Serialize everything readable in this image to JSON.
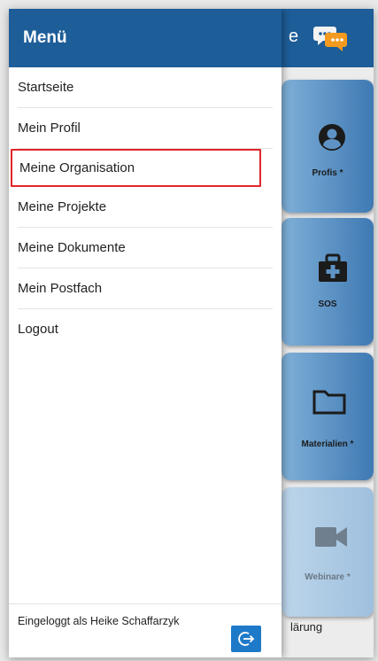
{
  "drawer": {
    "title": "Menü",
    "items": [
      {
        "label": "Startseite"
      },
      {
        "label": "Mein Profil"
      },
      {
        "label": "Meine Organisation"
      },
      {
        "label": "Meine Projekte"
      },
      {
        "label": "Meine Dokumente"
      },
      {
        "label": "Mein Postfach"
      },
      {
        "label": "Logout"
      }
    ],
    "footer_text": "Eingeloggt als Heike Schaffarzyk",
    "logout_icon": "logout-icon"
  },
  "background": {
    "title_fragment": "e",
    "tiles": [
      {
        "label": "Profis *",
        "icon": "user-icon"
      },
      {
        "label": "SOS",
        "icon": "first-aid-kit-icon"
      },
      {
        "label": "Materialien *",
        "icon": "folder-icon"
      },
      {
        "label": "Webinare *",
        "icon": "video-camera-icon"
      }
    ],
    "bottom_text": "lärung"
  },
  "colors": {
    "header_blue": "#1d5d98",
    "highlight_red": "#e0262c",
    "button_blue": "#1e7ac8"
  }
}
